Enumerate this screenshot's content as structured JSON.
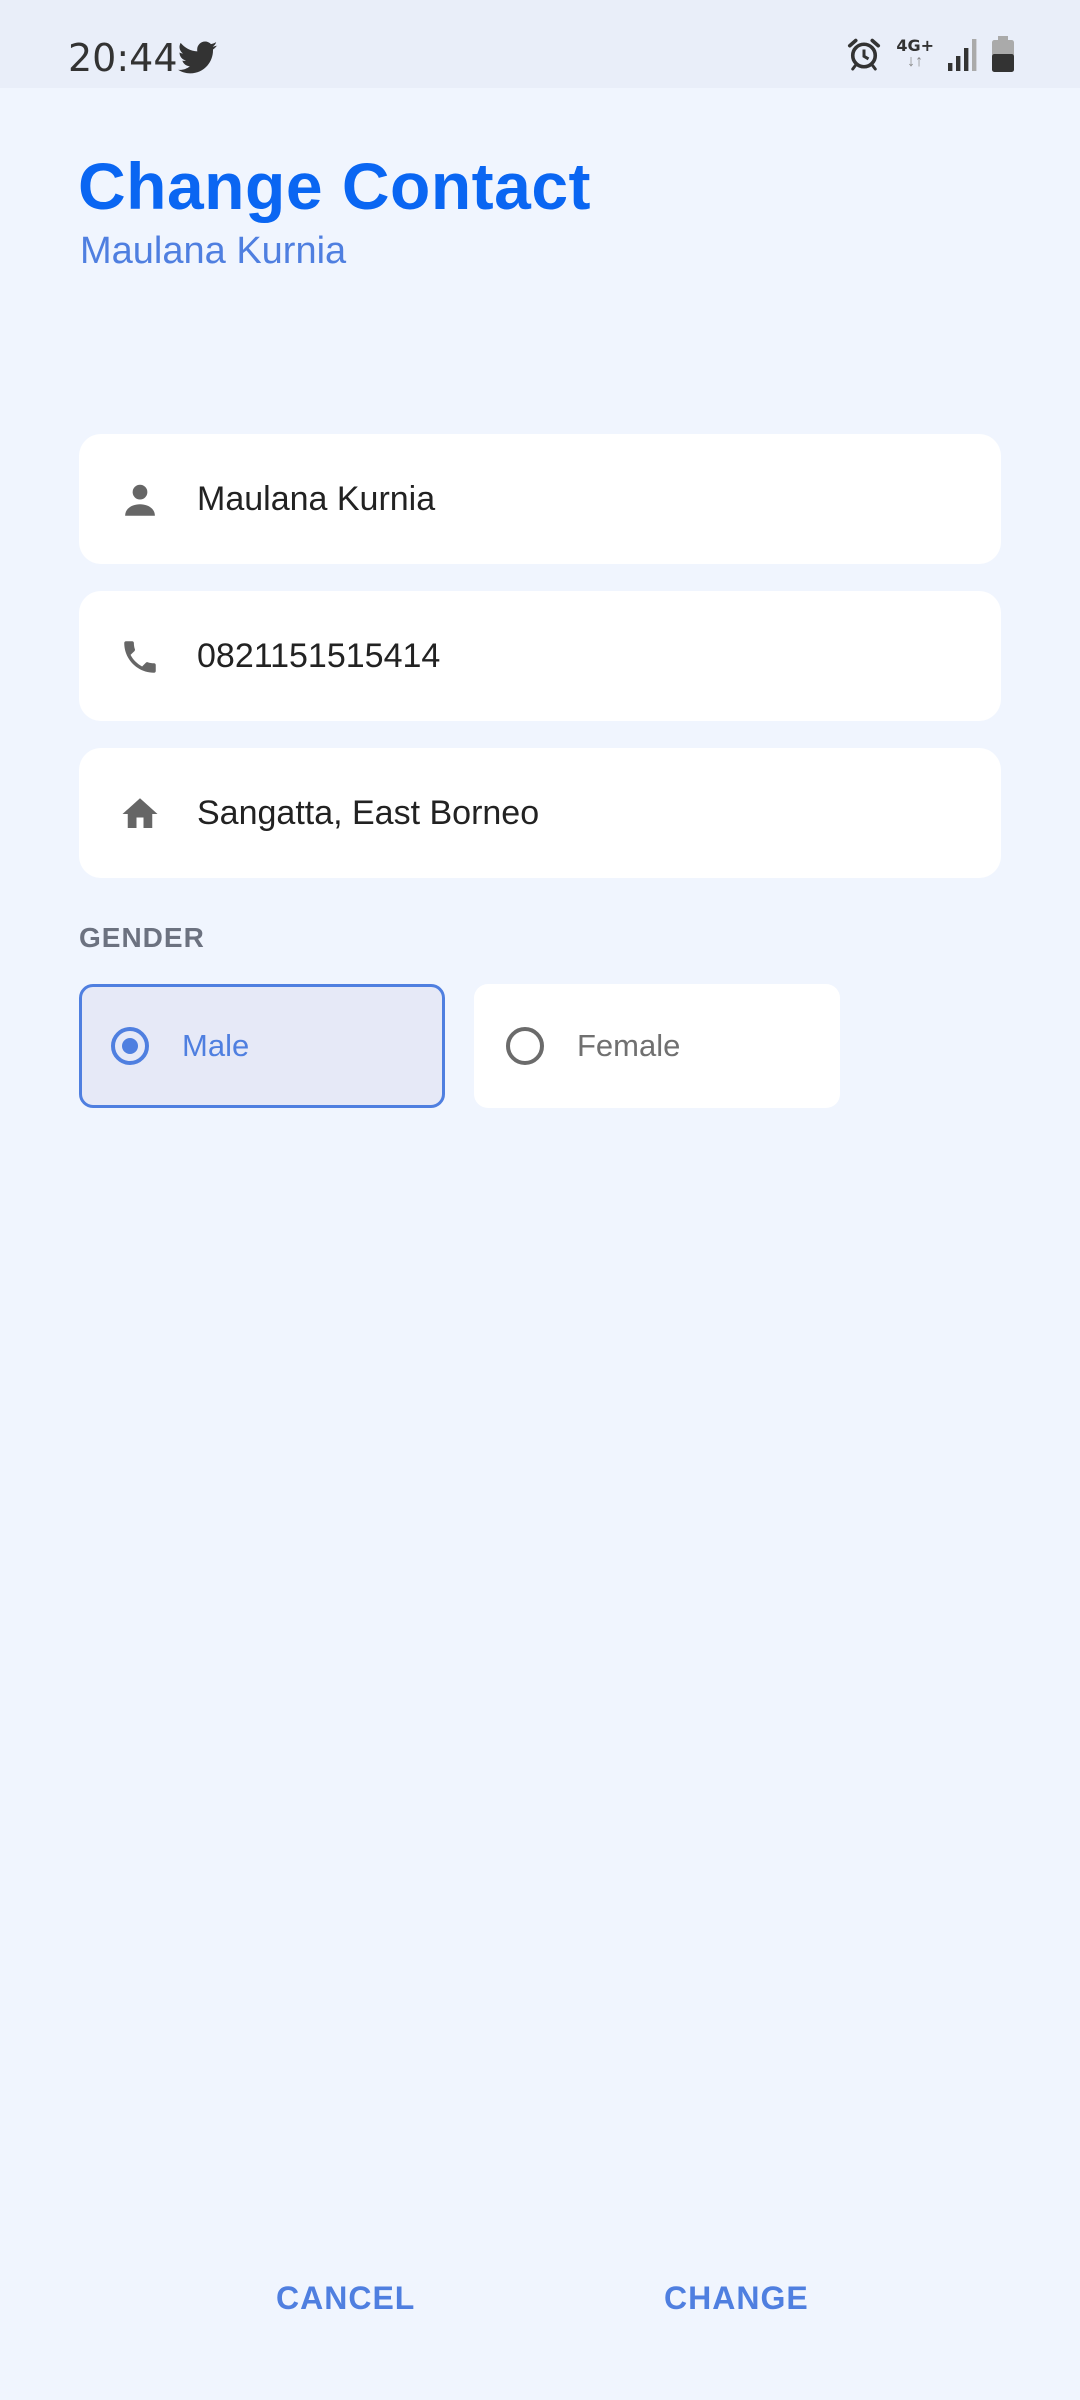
{
  "status_bar": {
    "time": "20:44",
    "network_label": "4G+"
  },
  "header": {
    "title": "Change Contact",
    "subtitle": "Maulana Kurnia"
  },
  "form": {
    "name_value": "Maulana Kurnia",
    "phone_value": "0821151515414",
    "address_value": "Sangatta, East Borneo",
    "gender_label": "GENDER",
    "gender_options": [
      {
        "label": "Male",
        "selected": true
      },
      {
        "label": "Female",
        "selected": false
      }
    ]
  },
  "actions": {
    "cancel_label": "CANCEL",
    "change_label": "CHANGE"
  },
  "colors": {
    "accent": "#4f7fe0",
    "title": "#0a66f2",
    "background": "#f0f5fe"
  }
}
